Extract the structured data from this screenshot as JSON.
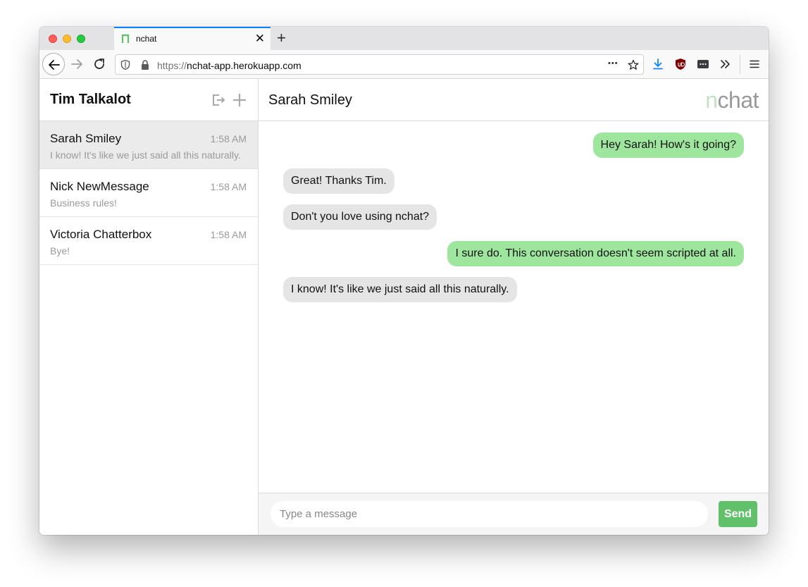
{
  "browser": {
    "tab_title": "nchat",
    "tab_close": "✕",
    "new_tab": "+",
    "url_scheme": "https://",
    "url_host": "nchat-app.herokuapp.com",
    "overflow_dots": "•••"
  },
  "sidebar": {
    "user_name": "Tim Talkalot",
    "conversations": [
      {
        "name": "Sarah Smiley",
        "time": "1:58 AM",
        "preview": "I know! It's like we just said all this naturally."
      },
      {
        "name": "Nick NewMessage",
        "time": "1:58 AM",
        "preview": "Business rules!"
      },
      {
        "name": "Victoria Chatterbox",
        "time": "1:58 AM",
        "preview": "Bye!"
      }
    ]
  },
  "chat": {
    "title": "Sarah Smiley",
    "logo_n": "n",
    "logo_rest": "chat",
    "messages": [
      {
        "text": "Hey Sarah! How's it going?",
        "direction": "out"
      },
      {
        "text": "Great! Thanks Tim.",
        "direction": "in"
      },
      {
        "text": "Don't you love using nchat?",
        "direction": "in"
      },
      {
        "text": "I sure do. This conversation doesn't seem scripted at all.",
        "direction": "out"
      },
      {
        "text": "I know! It's like we just said all this naturally.",
        "direction": "in"
      }
    ]
  },
  "composer": {
    "placeholder": "Type a message",
    "value": "",
    "send_label": "Send"
  },
  "colors": {
    "outgoing_bubble": "#9ee59e",
    "incoming_bubble": "#e5e5e5",
    "send_button": "#61c16b",
    "accent_tab": "#0a84ff"
  }
}
